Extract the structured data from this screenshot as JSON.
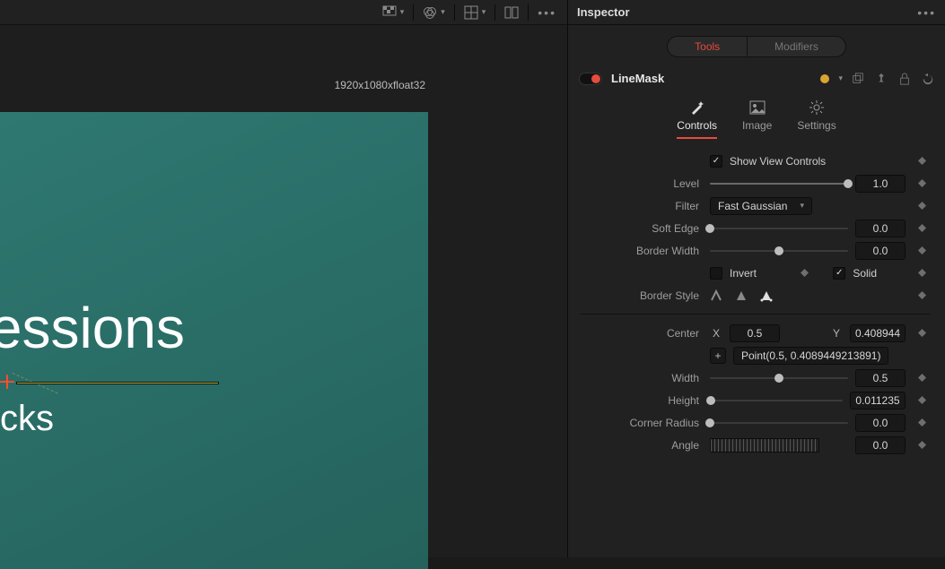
{
  "viewer": {
    "canvas_info": "1920x1080xfloat32",
    "title_text": "xpressions",
    "subtitle_text": "nd Tricks"
  },
  "inspector": {
    "title": "Inspector",
    "pill_tools": "Tools",
    "pill_modifiers": "Modifiers",
    "node_name": "LineMask",
    "tab_controls": "Controls",
    "tab_image": "Image",
    "tab_settings": "Settings",
    "show_view_controls_label": "Show View Controls",
    "level_label": "Level",
    "level_value": "1.0",
    "filter_label": "Filter",
    "filter_value": "Fast Gaussian",
    "softedge_label": "Soft Edge",
    "softedge_value": "0.0",
    "borderwidth_label": "Border Width",
    "borderwidth_value": "0.0",
    "invert_label": "Invert",
    "solid_label": "Solid",
    "borderstyle_label": "Border Style",
    "center_label": "Center",
    "center_x_key": "X",
    "center_x_value": "0.5",
    "center_y_key": "Y",
    "center_y_value": "0.408944",
    "center_expression": "Point(0.5, 0.4089449213891)",
    "width_label": "Width",
    "width_value": "0.5",
    "height_label": "Height",
    "height_value": "0.011235",
    "corner_label": "Corner Radius",
    "corner_value": "0.0",
    "angle_label": "Angle",
    "angle_value": "0.0"
  }
}
